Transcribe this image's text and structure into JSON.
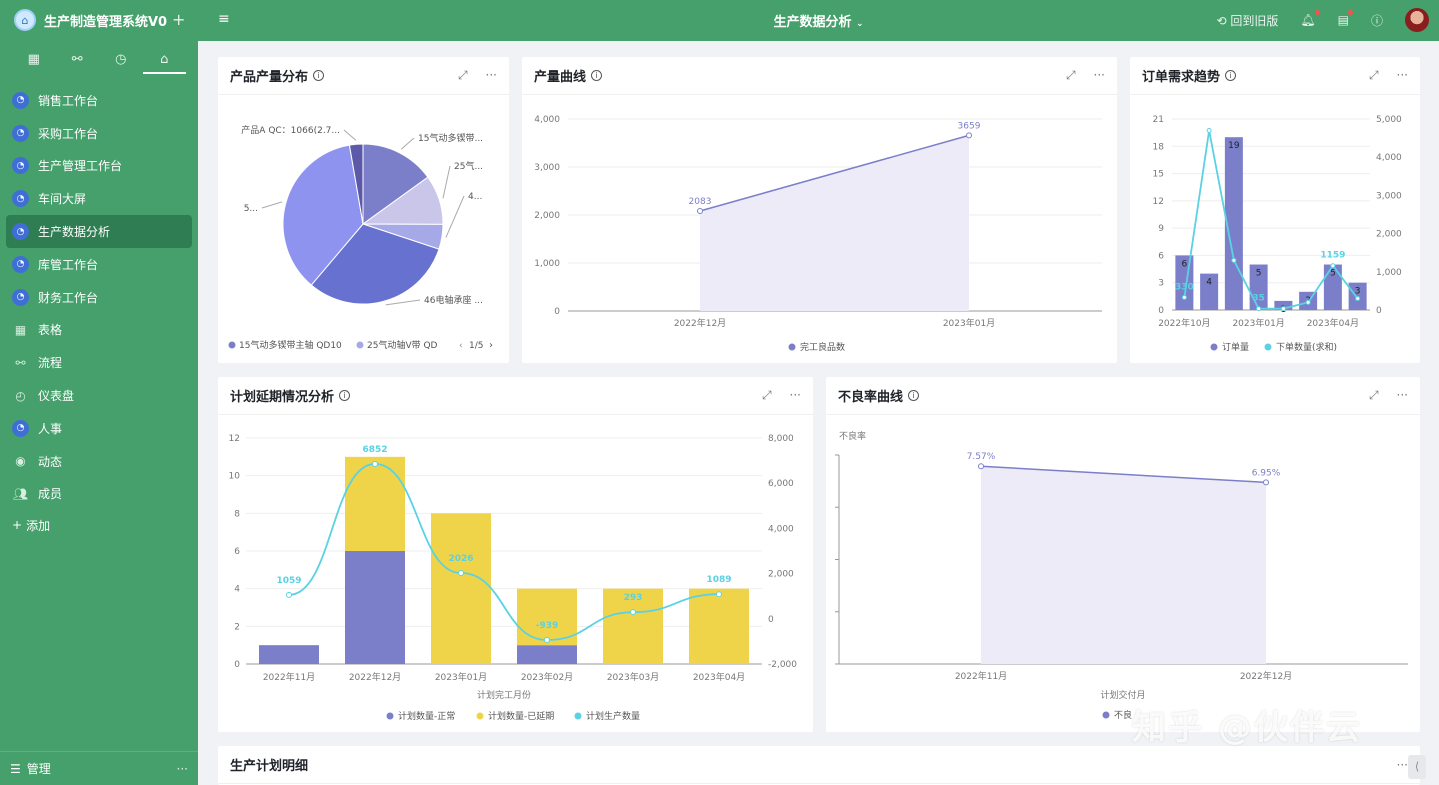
{
  "app": {
    "title": "生产制造管理系统V0",
    "logo_icon": "house-icon"
  },
  "sidebar": {
    "tabs": [
      {
        "icon": "grid-icon",
        "glyph": "▦"
      },
      {
        "icon": "flow-icon",
        "glyph": "⚯"
      },
      {
        "icon": "clock-icon",
        "glyph": "◷"
      },
      {
        "icon": "home-icon",
        "glyph": "⌂"
      }
    ],
    "items": [
      {
        "label": "销售工作台",
        "icon": "dashboard-icon"
      },
      {
        "label": "采购工作台",
        "icon": "dashboard-icon"
      },
      {
        "label": "生产管理工作台",
        "icon": "dashboard-icon"
      },
      {
        "label": "车间大屏",
        "icon": "dashboard-icon"
      },
      {
        "label": "生产数据分析",
        "icon": "dashboard-icon"
      },
      {
        "label": "库管工作台",
        "icon": "dashboard-icon"
      },
      {
        "label": "财务工作台",
        "icon": "dashboard-icon"
      },
      {
        "label": "表格",
        "icon": "table-icon"
      },
      {
        "label": "流程",
        "icon": "flow-icon"
      },
      {
        "label": "仪表盘",
        "icon": "gauge-icon"
      },
      {
        "label": "人事",
        "icon": "dashboard-icon"
      },
      {
        "label": "动态",
        "icon": "activity-icon"
      },
      {
        "label": "成员",
        "icon": "members-icon"
      }
    ],
    "active_index": 4,
    "add_label": "添加",
    "manage_label": "管理",
    "more_label": "···"
  },
  "topbar": {
    "page_title": "生产数据分析",
    "back_label": "回到旧版"
  },
  "cards": {
    "pie": {
      "title": "产品产量分布",
      "legend_page": "1/5"
    },
    "output": {
      "title": "产量曲线"
    },
    "orders": {
      "title": "订单需求趋势"
    },
    "delay": {
      "title": "计划延期情况分析"
    },
    "defect": {
      "title": "不良率曲线"
    },
    "plan": {
      "title": "生产计划明细"
    }
  },
  "watermark": "知乎 @伙伴云",
  "colors": {
    "brand": "#45a06c",
    "purple": "#7b7fc9",
    "yellow": "#efd44a",
    "cyan": "#5ad2e3"
  },
  "chart_data": [
    {
      "type": "pie",
      "title": "产品产量分布",
      "slices": [
        {
          "label": "15气动多锲带...",
          "value": 15
        },
        {
          "label": "25气...",
          "value": 10
        },
        {
          "label": "4...",
          "value": 5
        },
        {
          "label": "46电轴承座 ...",
          "value": 31
        },
        {
          "label": "5...",
          "value": 36
        },
        {
          "label": "产品A QC：1066(2.7...",
          "value": 2.7
        }
      ],
      "legend": [
        "15气动多锲带主轴 QD10",
        "25气动轴V带 QD"
      ]
    },
    {
      "type": "line",
      "title": "产量曲线",
      "x": [
        "2022年12月",
        "2023年01月"
      ],
      "series": [
        {
          "name": "完工良品数",
          "values": [
            2083,
            3659
          ]
        }
      ],
      "ylim": [
        0,
        4000
      ],
      "yticks": [
        "0",
        "1,000",
        "2,000",
        "3,000",
        "4,000"
      ]
    },
    {
      "type": "bar",
      "title": "订单需求趋势",
      "categories": [
        "2022年10月",
        "2022年11月",
        "2022年12月",
        "2023年01月",
        "2023年02月",
        "2023年03月",
        "2023年04月",
        "2023年05月"
      ],
      "xticks": [
        "2022年10月",
        "2023年01月",
        "2023年04月"
      ],
      "series": [
        {
          "name": "订单量",
          "values": [
            6,
            4,
            19,
            5,
            1,
            2,
            5,
            3
          ]
        },
        {
          "name": "下单数量(求和)",
          "values": [
            330,
            4700,
            1300,
            35,
            35,
            200,
            1159,
            300
          ]
        }
      ],
      "series_labels": [
        "330",
        "",
        "",
        "35",
        "",
        "",
        "1159",
        ""
      ],
      "ylim_left": [
        0,
        21
      ],
      "yticks_left": [
        "0",
        "3",
        "6",
        "9",
        "12",
        "15",
        "18",
        "21"
      ],
      "ylim_right": [
        0,
        5000
      ],
      "yticks_right": [
        "0",
        "1,000",
        "2,000",
        "3,000",
        "4,000",
        "5,000"
      ]
    },
    {
      "type": "bar",
      "title": "计划延期情况分析",
      "categories": [
        "2022年11月",
        "2022年12月",
        "2023年01月",
        "2023年02月",
        "2023年03月",
        "2023年04月"
      ],
      "xlabel": "计划完工月份",
      "series": [
        {
          "name": "计划数量-正常",
          "values": [
            1,
            6,
            0,
            1,
            0,
            0
          ]
        },
        {
          "name": "计划数量-已延期",
          "values": [
            0,
            5,
            8,
            3,
            4,
            4
          ]
        },
        {
          "name": "计划生产数量",
          "values": [
            1059,
            6852,
            2026,
            -939,
            293,
            1089
          ]
        }
      ],
      "ylim_left": [
        0,
        12
      ],
      "yticks_left": [
        "0",
        "2",
        "4",
        "6",
        "8",
        "10",
        "12"
      ],
      "ylim_right": [
        -2000,
        8000
      ],
      "yticks_right": [
        "-2,000",
        "0",
        "2,000",
        "4,000",
        "6,000",
        "8,000"
      ]
    },
    {
      "type": "area",
      "title": "不良率曲线",
      "ylabel": "不良率",
      "xlabel": "计划交付月",
      "x": [
        "2022年11月",
        "2022年12月"
      ],
      "series": [
        {
          "name": "不良率",
          "values": [
            7.57,
            6.95
          ],
          "labels": [
            "7.57%",
            "6.95%"
          ]
        }
      ],
      "legend_label": "不良"
    }
  ]
}
